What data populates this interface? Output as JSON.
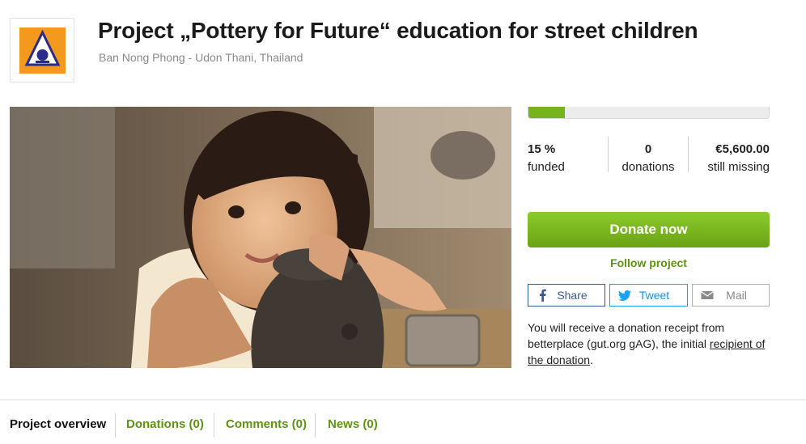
{
  "header": {
    "logo_icon": "project-logo",
    "title": "Project „Pottery for Future“ education for street children",
    "location": "Ban Nong Phong - Udon Thani, Thailand"
  },
  "hero": {
    "image": "girl-with-clay-pot-photo"
  },
  "funding": {
    "progress_fraction": 0.15,
    "funded_value": "15 %",
    "funded_label": "funded",
    "donations_value": "0",
    "donations_label": "donations",
    "missing_value": "€5,600.00",
    "missing_label": "still missing"
  },
  "actions": {
    "donate_label": "Donate now",
    "follow_label": "Follow project",
    "share_label": "Share",
    "tweet_label": "Tweet",
    "mail_label": "Mail"
  },
  "receipt": {
    "text": "You will receive a donation receipt from betterplace (gut.org gAG), the initial ",
    "link": "recipient of the donation",
    "end": "."
  },
  "tabs": [
    {
      "label": "Project overview"
    },
    {
      "label": "Donations (0)"
    },
    {
      "label": "Comments (0)"
    },
    {
      "label": "News (0)"
    }
  ],
  "colors": {
    "accent_green": "#77b31e",
    "link_green": "#5c9412",
    "facebook": "#3b5998",
    "twitter": "#1da1f2"
  }
}
